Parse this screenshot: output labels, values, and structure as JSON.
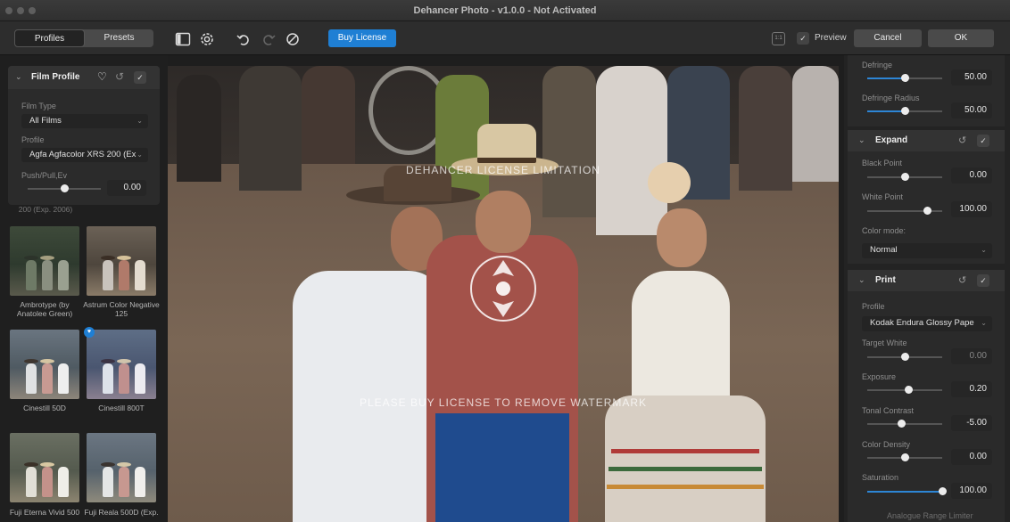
{
  "window": {
    "title": "Dehancer Photo - v1.0.0 - Not Activated"
  },
  "toolbar": {
    "tabs": [
      "Profiles",
      "Presets"
    ],
    "buy_license": "Buy License",
    "one_to_one": "1:1",
    "preview_label": "Preview",
    "cancel": "Cancel",
    "ok": "OK"
  },
  "film_profile": {
    "title": "Film Profile",
    "film_type_label": "Film Type",
    "film_type_value": "All Films",
    "profile_label": "Profile",
    "profile_value": "Agfa Agfacolor XRS 200 (Ex",
    "push_pull_label": "Push/Pull,Ev",
    "push_pull_value": "0.00",
    "push_pull_level": 0.5
  },
  "film_list": {
    "partial_caption": "200 (Exp. 2006)",
    "items": [
      {
        "label": "Ambrotype (by Anatolee Green)"
      },
      {
        "label": "Astrum Color Negative 125"
      },
      {
        "label": "Cinestill 50D"
      },
      {
        "label": "Cinestill 800T"
      },
      {
        "label": "Fuji Eterna Vivid 500"
      },
      {
        "label": "Fuji Reala 500D (Exp."
      }
    ]
  },
  "watermark": {
    "top": "DEHANCER LICENSE LIMITATION",
    "bottom": "PLEASE BUY LICENSE TO REMOVE WATERMARK"
  },
  "right_panel": {
    "defringe": {
      "label": "Defringe",
      "value": "50.00",
      "level": 0.5
    },
    "defringe_radius": {
      "label": "Defringe Radius",
      "value": "50.00",
      "level": 0.5
    },
    "expand": {
      "title": "Expand",
      "black_point": {
        "label": "Black Point",
        "value": "0.00",
        "level": 0.5
      },
      "white_point": {
        "label": "White Point",
        "value": "100.00",
        "level": 0.8
      },
      "color_mode_label": "Color mode:",
      "color_mode_value": "Normal"
    },
    "print": {
      "title": "Print",
      "profile_label": "Profile",
      "profile_value": "Kodak Endura Glossy Pape",
      "target_white": {
        "label": "Target White",
        "value": "0.00",
        "level": 0.5
      },
      "exposure": {
        "label": "Exposure",
        "value": "0.20",
        "level": 0.55
      },
      "tonal_contrast": {
        "label": "Tonal Contrast",
        "value": "-5.00",
        "level": 0.45
      },
      "color_density": {
        "label": "Color Density",
        "value": "0.00",
        "level": 0.5
      },
      "saturation": {
        "label": "Saturation",
        "value": "100.00",
        "level": 1.0
      },
      "partial_label": "Analogue Range Limiter"
    }
  },
  "colors": {
    "accent": "#1f7fd4",
    "panel": "#2b2b2b",
    "background": "#1e1e1e"
  }
}
